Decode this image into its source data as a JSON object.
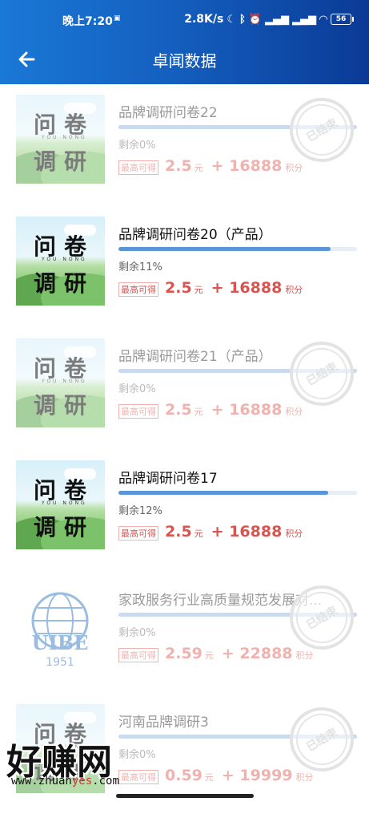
{
  "status_bar": {
    "time": "晚上7:20",
    "sim_icon": "sim-icon",
    "network_speed": "2.8K/s",
    "battery": "56"
  },
  "header": {
    "title": "卓闻数据",
    "back_icon": "arrow-left-icon"
  },
  "labels": {
    "max_earn": "最高可得",
    "currency_unit": "元",
    "points_unit": "积分",
    "ended_stamp": "已结束"
  },
  "surveys": [
    {
      "title": "品牌调研问卷22",
      "remaining": "剩余0%",
      "progress": 1.0,
      "amount": "2.5",
      "points": "+ 16888",
      "ended": true,
      "thumb": "survey-art"
    },
    {
      "title": "品牌调研问卷20（产品）",
      "remaining": "剩余11%",
      "progress": 0.89,
      "amount": "2.5",
      "points": "+ 16888",
      "ended": false,
      "thumb": "survey-art"
    },
    {
      "title": "品牌调研问卷21（产品）",
      "remaining": "剩余0%",
      "progress": 1.0,
      "amount": "2.5",
      "points": "+ 16888",
      "ended": true,
      "thumb": "survey-art"
    },
    {
      "title": "品牌调研问卷17",
      "remaining": "剩余12%",
      "progress": 0.88,
      "amount": "2.5",
      "points": "+ 16888",
      "ended": false,
      "thumb": "survey-art"
    },
    {
      "title": "家政服务行业高质量规范发展对...",
      "remaining": "剩余0%",
      "progress": 1.0,
      "amount": "2.59",
      "points": "+ 22888",
      "ended": true,
      "thumb": "uibe-logo"
    },
    {
      "title": "河南品牌调研3",
      "remaining": "剩余0%",
      "progress": 1.0,
      "amount": "0.59",
      "points": "+ 19999",
      "ended": true,
      "thumb": "survey-art"
    }
  ],
  "thumb_text": {
    "line1": "问卷",
    "line2": "调研",
    "sub": "YOU NONG",
    "uibe": "UIBE",
    "uibe_year": "1951"
  },
  "watermark": {
    "big": "好赚网",
    "small_pre": "www.zhuan",
    "small_hl": "yes",
    "small_post": ".com"
  }
}
